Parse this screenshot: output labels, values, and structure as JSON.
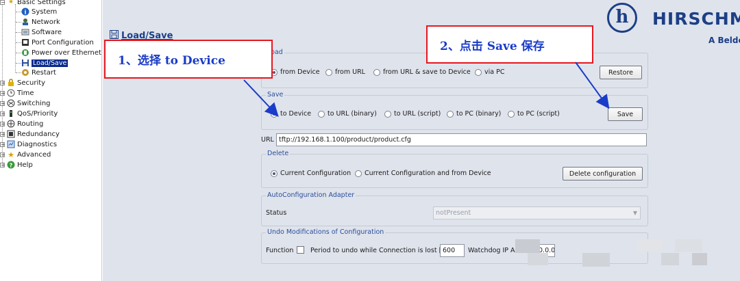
{
  "tree": {
    "basic_settings": "Basic Settings",
    "system": "System",
    "network": "Network",
    "software": "Software",
    "port_configuration": "Port Configuration",
    "power_over_ethernet": "Power over Ethernet",
    "load_save": "Load/Save",
    "restart": "Restart",
    "security": "Security",
    "time": "Time",
    "switching": "Switching",
    "qos_priority": "QoS/Priority",
    "routing": "Routing",
    "redundancy": "Redundancy",
    "diagnostics": "Diagnostics",
    "advanced": "Advanced",
    "help": "Help"
  },
  "logo": {
    "symbol": "h",
    "name": "HIRSCHM",
    "sub": "A Belde"
  },
  "page_title": "Load/Save",
  "load": {
    "title": "Load",
    "options": [
      "from Device",
      "from URL",
      "from URL & save to Device",
      "via PC"
    ],
    "selected": "from Device",
    "restore_button": "Restore"
  },
  "save": {
    "title": "Save",
    "options": [
      "to Device",
      "to URL (binary)",
      "to URL (script)",
      "to PC (binary)",
      "to PC (script)"
    ],
    "selected": "to Device",
    "save_button": "Save"
  },
  "url": {
    "label": "URL",
    "value": "tftp://192.168.1.100/product/product.cfg"
  },
  "delete": {
    "title": "Delete",
    "options": [
      "Current Configuration",
      "Current Configuration and from Device"
    ],
    "selected": "Current Configuration",
    "delete_button": "Delete configuration"
  },
  "autoconfig": {
    "title": "AutoConfiguration Adapter",
    "status_label": "Status",
    "status_value": "notPresent"
  },
  "undo": {
    "title": "Undo Modifications of Configuration",
    "function_label": "Function",
    "period_label": "Period to undo while Connection is lost [s]",
    "period_value": "600",
    "watchdog_label": "Watchdog IP A",
    "watchdog_value": "0.0.0"
  },
  "annotations": {
    "step1": "1、选择 to Device",
    "step2": "2、点击 Save 保存"
  },
  "colors": {
    "callout_border": "#e5171f",
    "callout_text": "#1a3cc8",
    "arrow": "#1a3cc8",
    "brand": "#1c3f86",
    "panel_bg": "#dfe3ec"
  }
}
